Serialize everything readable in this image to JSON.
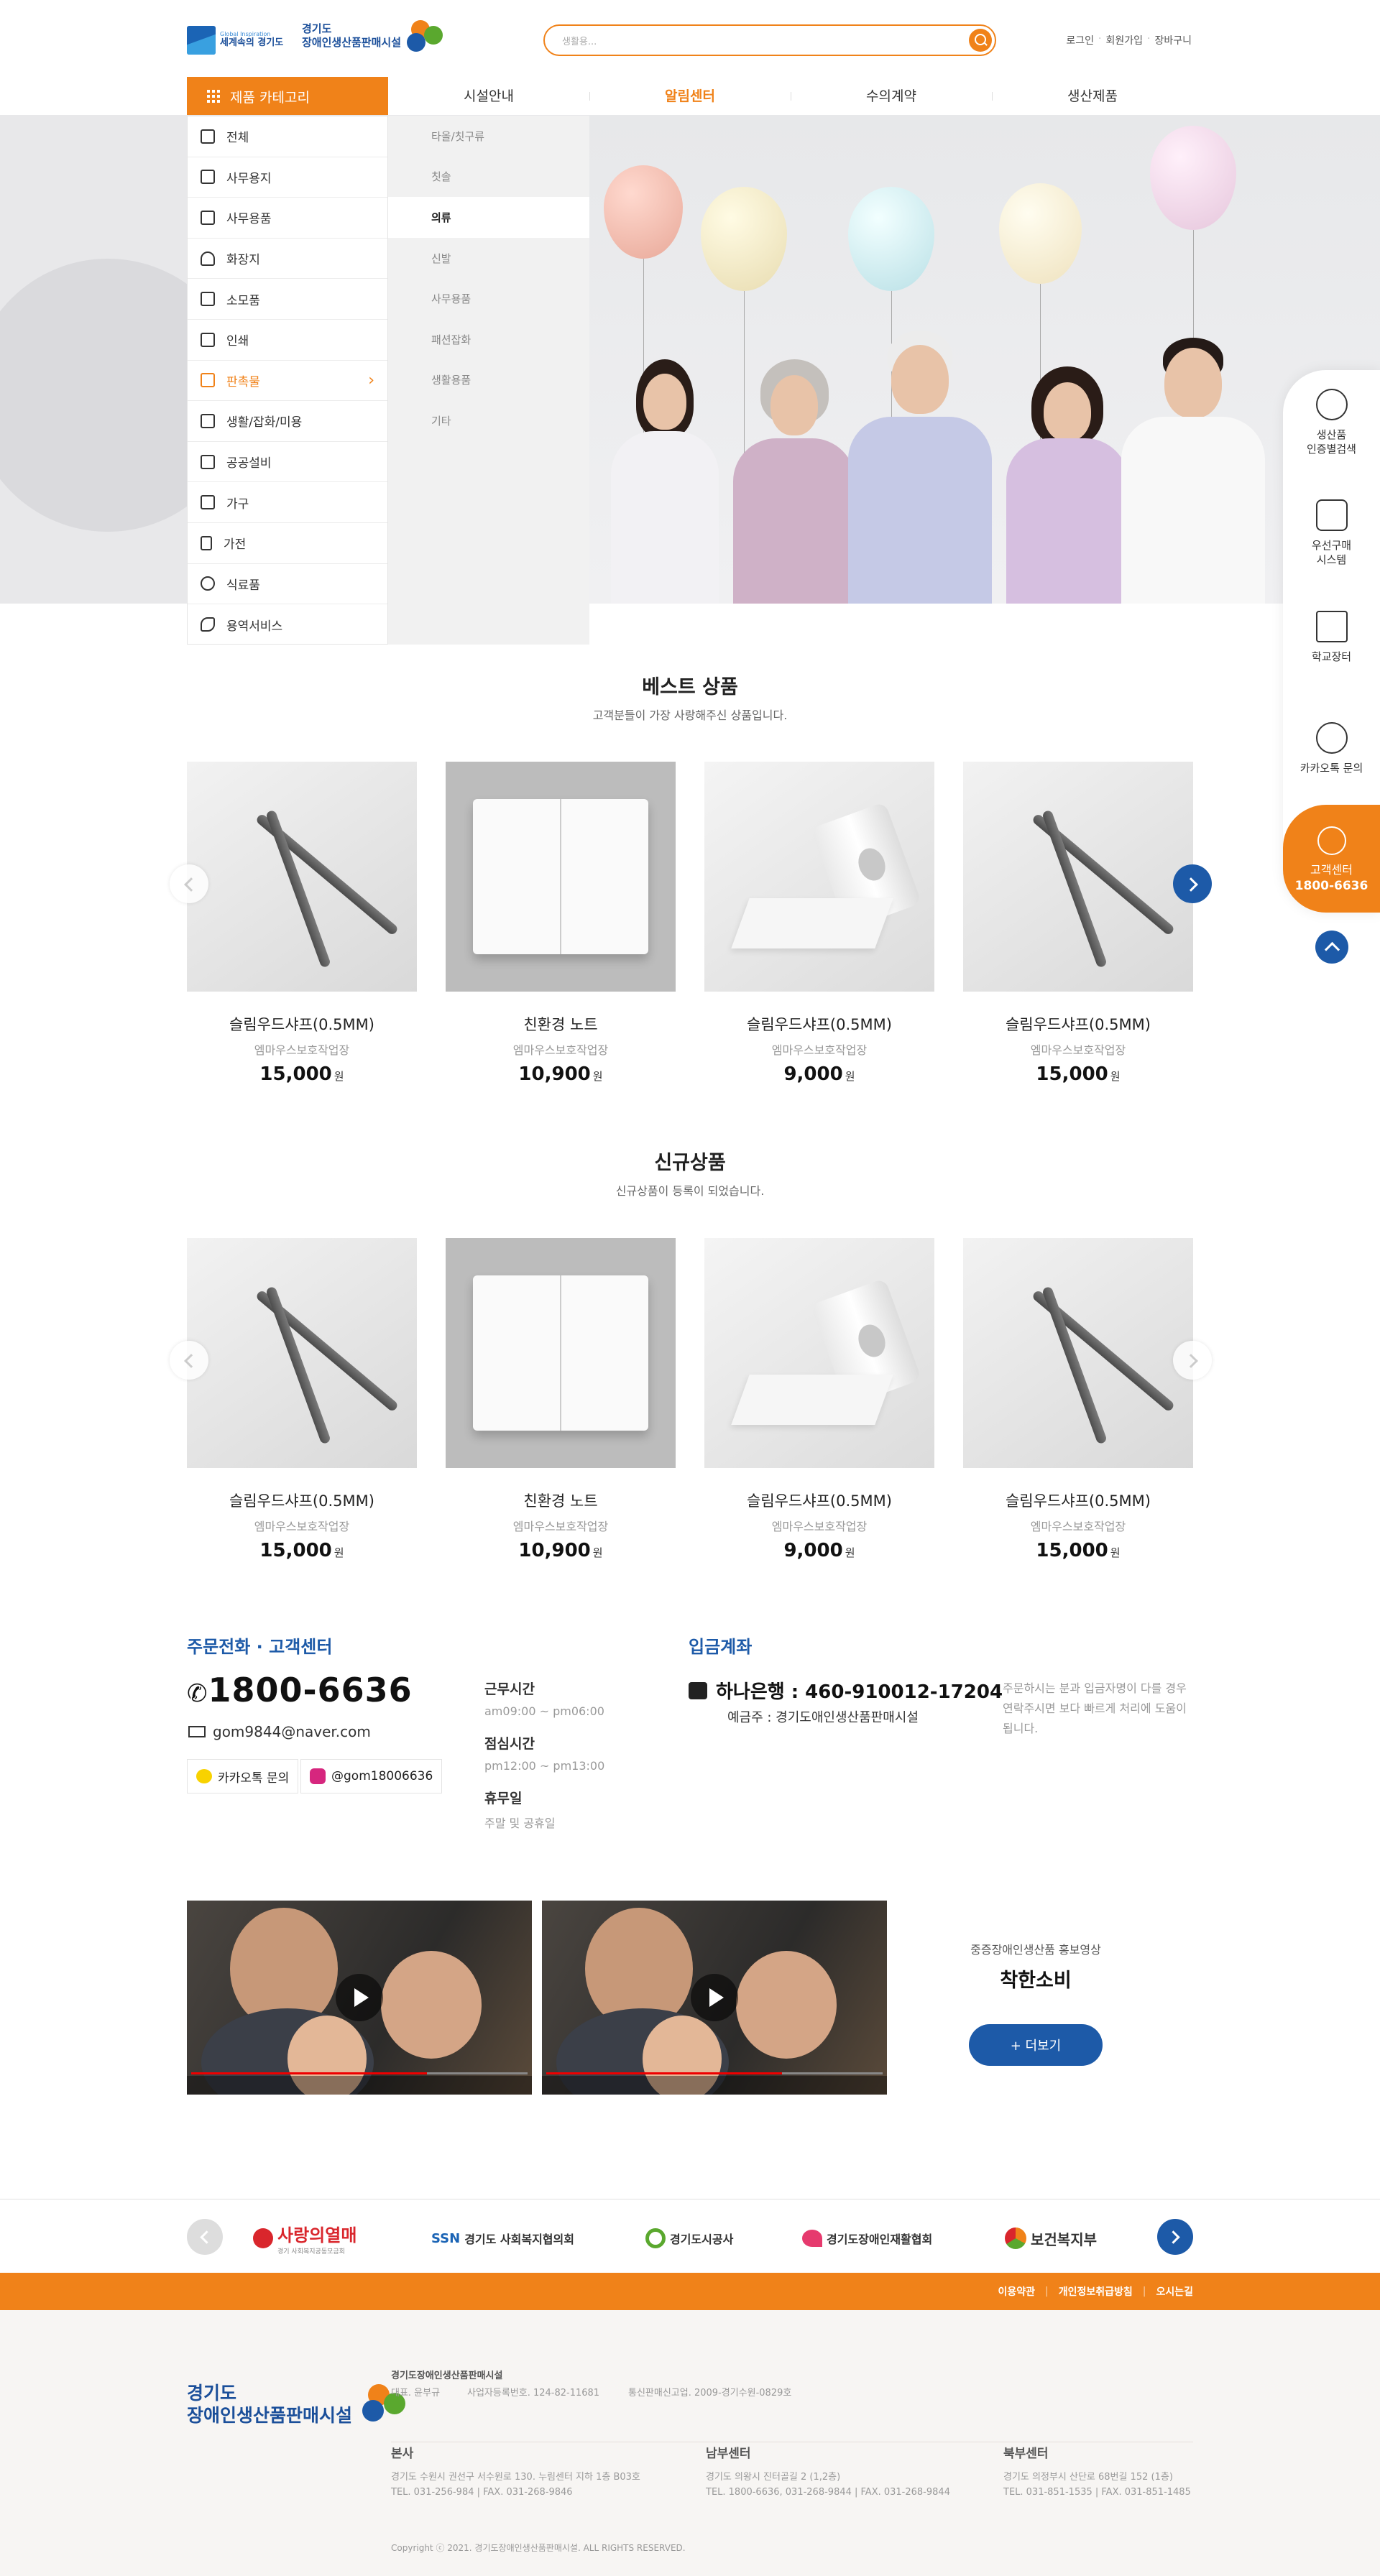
{
  "header": {
    "logo_small_top": "Global Inspiration",
    "logo_small_main": "세계속의 경기도",
    "logo_main_line1": "경기도",
    "logo_main_line2": "장애인생산품판매시설",
    "search_placeholder": "생활용...",
    "util": [
      "로그인",
      "회원가입",
      "장바구니"
    ]
  },
  "gnb": {
    "category_label": "제품 카테고리",
    "items": [
      "시설안내",
      "알림센터",
      "수의계약",
      "생산제품"
    ],
    "active": "알림센터"
  },
  "categories": [
    "전체",
    "사무용지",
    "사무용품",
    "화장지",
    "소모품",
    "인쇄",
    "판촉물",
    "생활/잡화/미용",
    "공공설비",
    "가구",
    "가전",
    "식료품",
    "용역서비스"
  ],
  "active_category": "판촉물",
  "subcategories": [
    "타올/칫구류",
    "칫솔",
    "의류",
    "신발",
    "사무용품",
    "패션잡화",
    "생활용품",
    "기타"
  ],
  "active_subcategory": "의류",
  "quick": {
    "items": [
      "생산품\n인증별검색",
      "우선구매\n시스템",
      "학교장터",
      "카카오톡 문의"
    ],
    "cs_label": "고객센터",
    "cs_phone": "1800-6636"
  },
  "best": {
    "title": "베스트 상품",
    "subtitle": "고객분들이 가장 사랑해주신 상품입니다.",
    "products": [
      {
        "name": "슬림우드샤프(0.5MM)",
        "seller": "엠마우스보호작업장",
        "price": "15,000",
        "unit": "원",
        "img": "pencil"
      },
      {
        "name": "친환경 노트",
        "seller": "엠마우스보호작업장",
        "price": "10,900",
        "unit": "원",
        "img": "notebook"
      },
      {
        "name": "슬림우드샤프(0.5MM)",
        "seller": "엠마우스보호작업장",
        "price": "9,000",
        "unit": "원",
        "img": "tissue"
      },
      {
        "name": "슬림우드샤프(0.5MM)",
        "seller": "엠마우스보호작업장",
        "price": "15,000",
        "unit": "원",
        "img": "pencil"
      }
    ]
  },
  "new": {
    "title": "신규상품",
    "subtitle": "신규상품이 등록이 되었습니다.",
    "products": [
      {
        "name": "슬림우드샤프(0.5MM)",
        "seller": "엠마우스보호작업장",
        "price": "15,000",
        "unit": "원",
        "img": "pencil"
      },
      {
        "name": "친환경 노트",
        "seller": "엠마우스보호작업장",
        "price": "10,900",
        "unit": "원",
        "img": "notebook"
      },
      {
        "name": "슬림우드샤프(0.5MM)",
        "seller": "엠마우스보호작업장",
        "price": "9,000",
        "unit": "원",
        "img": "tissue"
      },
      {
        "name": "슬림우드샤프(0.5MM)",
        "seller": "엠마우스보호작업장",
        "price": "15,000",
        "unit": "원",
        "img": "pencil"
      }
    ]
  },
  "contact": {
    "heading": "주문전화 · 고객센터",
    "phone": "1800-6636",
    "email": "gom9844@naver.com",
    "kakao": "카카오톡 문의",
    "instagram": "@gom18006636",
    "hours": [
      {
        "label": "근무시간",
        "value": "am09:00 ~ pm06:00"
      },
      {
        "label": "점심시간",
        "value": "pm12:00 ~ pm13:00"
      },
      {
        "label": "휴무일",
        "value": "주말 및 공휴일"
      }
    ]
  },
  "account": {
    "heading": "입금계좌",
    "bank": "하나은행 : 460-910012-17204",
    "holder": "예금주 : 경기도애인생산품판매시설",
    "note": "주문하시는 분과 입금자명이 다를 경우 연락주시면 보다 빠르게 처리에 도움이 됩니다."
  },
  "video": {
    "sub": "중증장애인생산품 홍보영상",
    "title": "착한소비",
    "more": "+ 더보기"
  },
  "partners": [
    "사랑의열매",
    "경기도 사회복지협의회",
    "경기도시공사",
    "경기도장애인재활협회",
    "보건복지부"
  ],
  "partner_sub": "경기 사회복지공동모금회",
  "footer": {
    "links": [
      "이용약관",
      "개인정보취급방침",
      "오시는길"
    ],
    "logo_line1": "경기도",
    "logo_line2": "장애인생산품판매시설",
    "company": "경기도장애인생산품판매시설",
    "rep": "대표. 윤부규",
    "bizno": "사업자등록번호. 124-82-11681",
    "mailorder": "통신판매신고업. 2009-경기수원-0829호",
    "branches": [
      {
        "name": "본사",
        "addr": "경기도 수원시 권선구 서수원로 130. 누림센터 지하 1층 B03호",
        "tel": "TEL. 031-256-984  |  FAX. 031-268-9846"
      },
      {
        "name": "남부센터",
        "addr": "경기도 의왕시 진터골길 2 (1,2층)",
        "tel": "TEL. 1800-6636, 031-268-9844  |  FAX. 031-268-9844"
      },
      {
        "name": "북부센터",
        "addr": "경기도 의정부시 산단로 68번길 152 (1층)",
        "tel": "TEL. 031-851-1535  |  FAX. 031-851-1485"
      }
    ],
    "copyright": "Copyright ⓒ 2021. 경기도장애인생산품판매시설. ALL RIGHTS RESERVED."
  },
  "colors": {
    "accent": "#f08219",
    "brand": "#1d5aa8"
  }
}
